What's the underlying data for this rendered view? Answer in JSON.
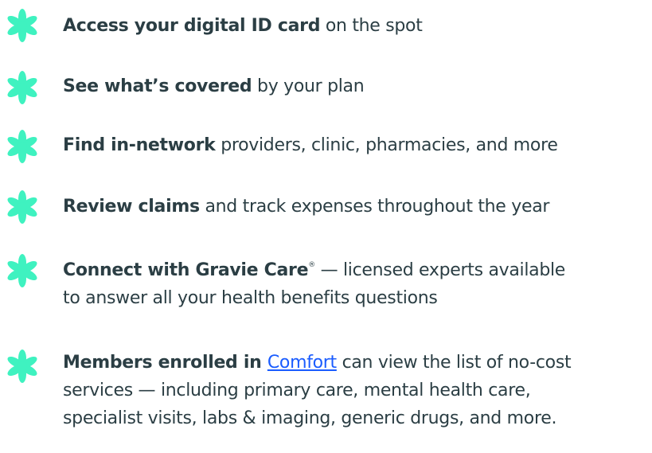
{
  "accent_color": "#3ff2c0",
  "text_color": "#2b3e44",
  "link_color": "#1a5cff",
  "icon": "asterisk-flower-icon",
  "items": [
    {
      "bold": "Access your digital ID card",
      "rest": " on the spot"
    },
    {
      "bold": "See what’s covered",
      "rest": " by your plan"
    },
    {
      "bold": "Find in-network",
      "rest": " providers, clinic, pharmacies, and more"
    },
    {
      "bold": "Review claims",
      "rest": " and track expenses throughout the year"
    },
    {
      "bold": "Connect with Gravie Care",
      "sup": "®",
      "rest_line1": " — licensed experts available",
      "line2": "to answer all your health benefits questions"
    },
    {
      "bold": "Members enrolled in ",
      "link": "Comfort",
      "rest_line1": " can view the list of no-cost",
      "line2": "services — including primary care, mental health care,",
      "line3": "specialist visits, labs & imaging, generic drugs, and more."
    }
  ]
}
